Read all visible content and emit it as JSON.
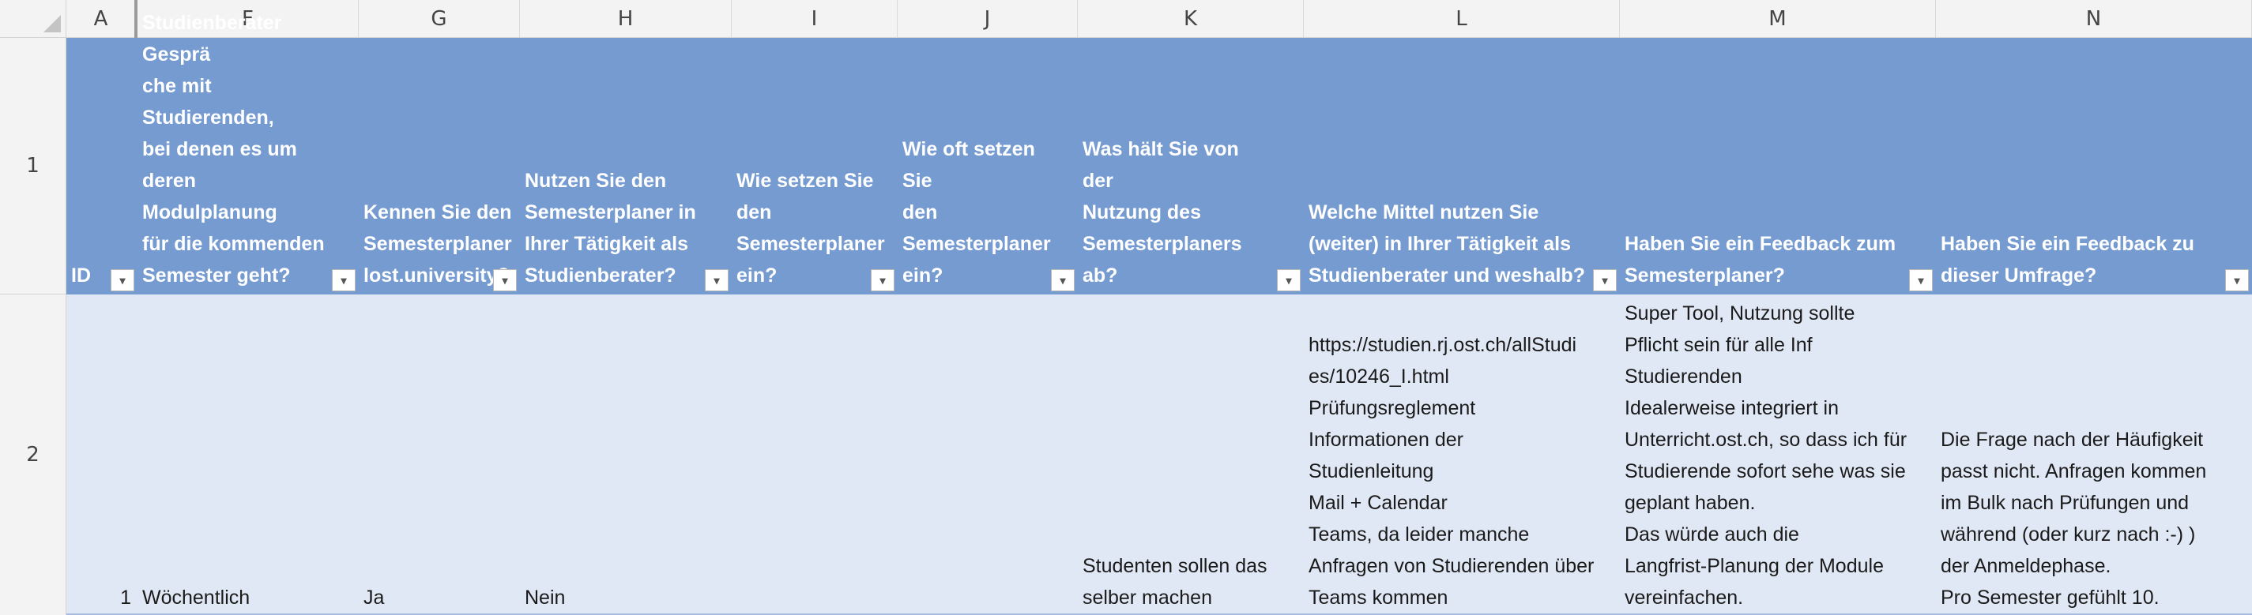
{
  "columns": [
    "A",
    "F",
    "G",
    "H",
    "I",
    "J",
    "K",
    "L",
    "M",
    "N"
  ],
  "rows": [
    "1",
    "2"
  ],
  "headers": {
    "id": "ID",
    "f": "Wie oft führen Sie als\nStudienberater Gesprä\nche mit Studierenden,\nbei denen es um\nderen Modulplanung\nfür die kommenden\nSemester geht?",
    "g": "Kennen Sie den\nSemesterplaner\n lost.university?",
    "h": " Nutzen Sie den\nSemesterplaner in\nIhrer Tätigkeit als\nStudienberater?",
    "i": "Wie setzen Sie\nden\nSemesterplaner\nein?",
    "j": "Wie oft setzen Sie\nden\nSemesterplaner\nein?",
    "k": "Was hält Sie von der\nNutzung des\nSemesterplaners ab?",
    "l": "Welche Mittel nutzen Sie\n(weiter) in Ihrer Tätigkeit als\nStudienberater und weshalb?",
    "m": "Haben Sie ein Feedback zum\nSemesterplaner?",
    "n": "Haben Sie ein Feedback zu\ndieser Umfrage?"
  },
  "row2": {
    "id": "1",
    "f": "Wöchentlich",
    "g": "Ja",
    "h": "Nein",
    "i": "",
    "j": "",
    "k": "Studenten sollen das\nselber machen",
    "l": "https://studien.rj.ost.ch/allStudi\nes/10246_I.html\nPrüfungsreglement\nInformationen der\nStudienleitung\nMail + Calendar\nTeams, da leider manche\nAnfragen von Studierenden über\nTeams kommen",
    "m": "Super Tool, Nutzung sollte\nPflicht sein für alle Inf\nStudierenden\nIdealerweise integriert in\nUnterricht.ost.ch, so dass ich für\nStudierende sofort sehe was sie\ngeplant haben.\nDas würde auch die\nLangfrist-Planung der Module\nvereinfachen.",
    "n": "Die Frage nach der Häufigkeit\npasst nicht. Anfragen kommen\nim Bulk nach Prüfungen und\nwährend (oder kurz nach :-) )\nder Anmeldephase.\nPro Semester gefühlt 10."
  },
  "icons": {
    "filter": "chevron-down-icon",
    "select_all": "select-all-icon"
  },
  "colors": {
    "header_fill": "#769bd0",
    "row_fill": "#e1e8f5",
    "header_text": "#ffffff"
  }
}
